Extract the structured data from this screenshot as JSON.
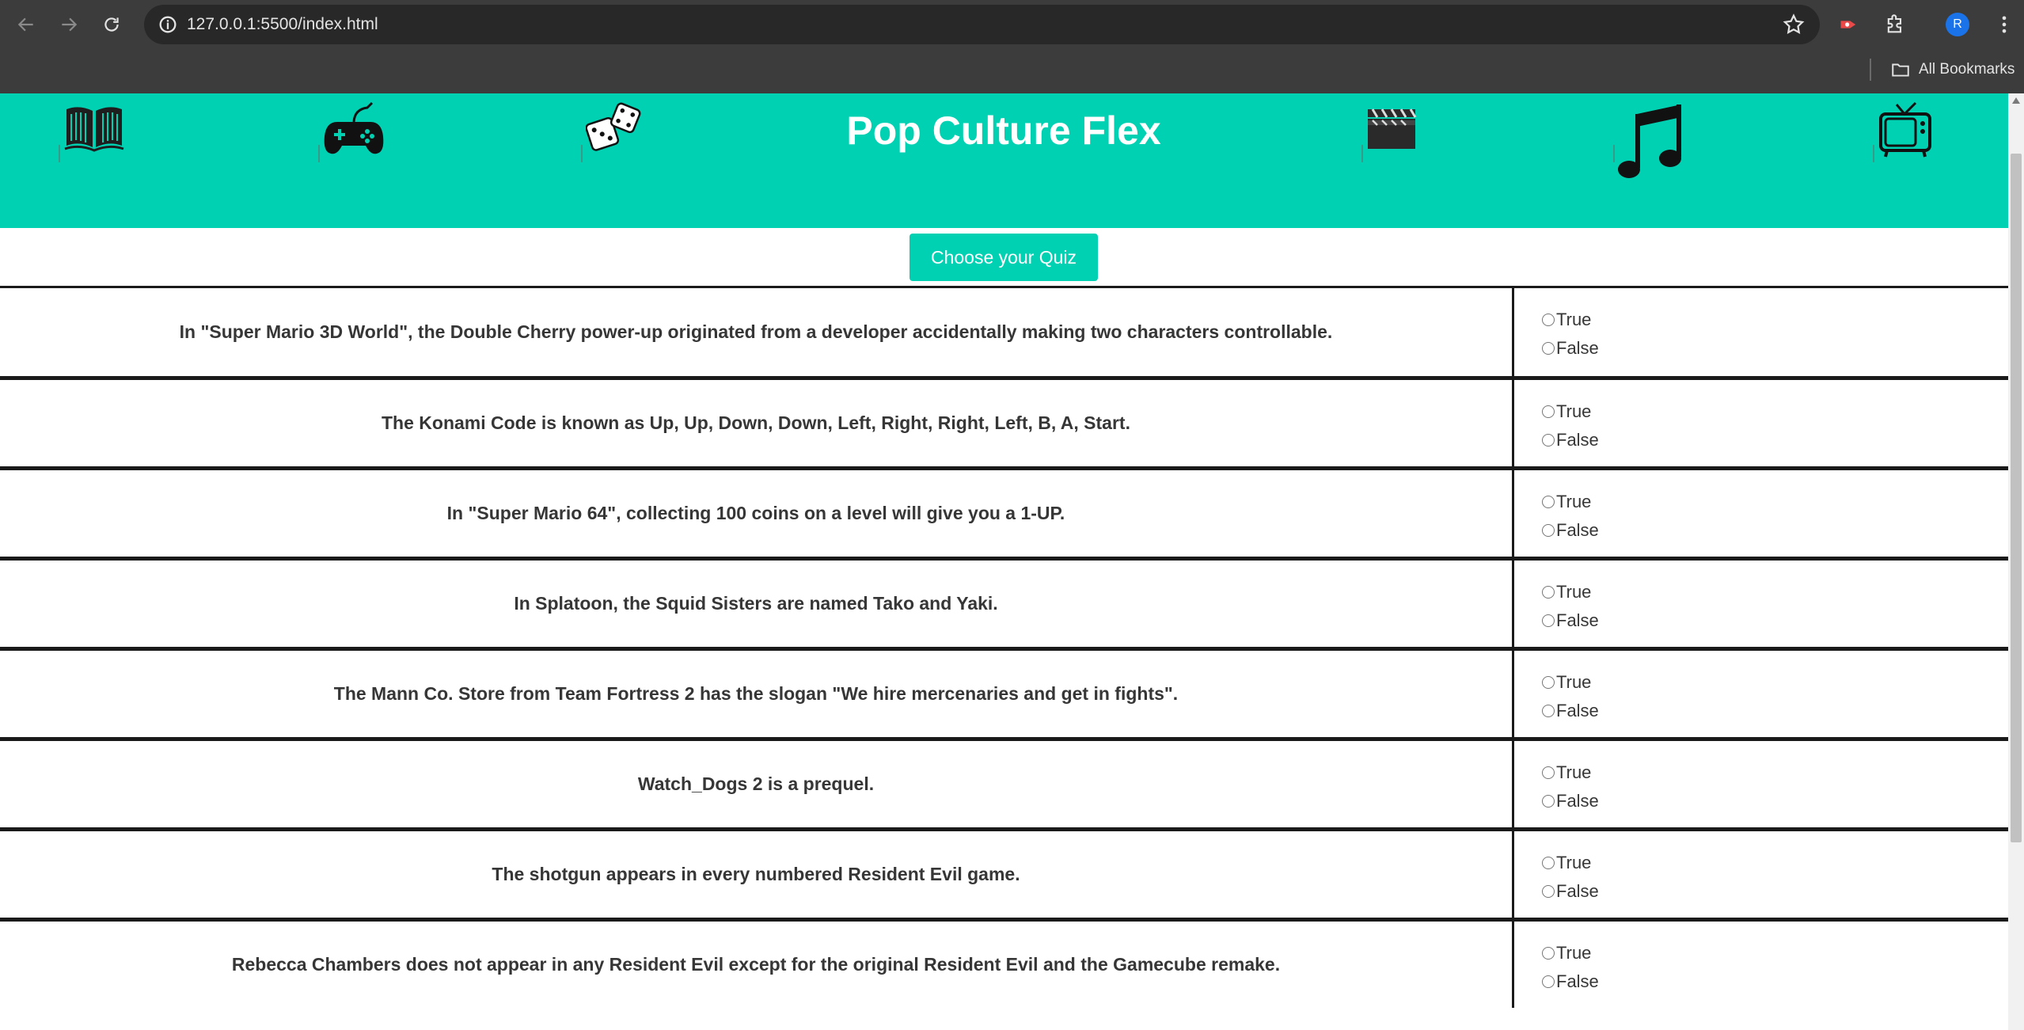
{
  "browser": {
    "url": "127.0.0.1:5500/index.html",
    "bookmarks_label": "All Bookmarks",
    "profile_initial": "R"
  },
  "header": {
    "title": "Pop Culture Flex",
    "background": "#00d1b2",
    "icons": [
      "book-icon",
      "gamepad-icon",
      "dice-icon",
      "clapperboard-icon",
      "music-note-icon",
      "tv-icon"
    ]
  },
  "quiz_button": {
    "label": "Choose your Quiz"
  },
  "answers": {
    "true_label": "True",
    "false_label": "False"
  },
  "questions": [
    {
      "text": "In \"Super Mario 3D World\", the Double Cherry power-up originated from a developer accidentally making two characters controllable."
    },
    {
      "text": "The Konami Code is known as Up, Up, Down, Down, Left, Right, Right, Left, B, A, Start."
    },
    {
      "text": "In \"Super Mario 64\", collecting 100 coins on a level will give you a 1-UP."
    },
    {
      "text": "In Splatoon, the Squid Sisters are named Tako and Yaki."
    },
    {
      "text": "The Mann Co. Store from Team Fortress 2 has the slogan \"We hire mercenaries and get in fights\"."
    },
    {
      "text": "Watch_Dogs 2 is a prequel."
    },
    {
      "text": "The shotgun appears in every numbered Resident Evil game."
    },
    {
      "text": "Rebecca Chambers does not appear in any Resident Evil except for the original Resident Evil and the Gamecube remake."
    }
  ]
}
